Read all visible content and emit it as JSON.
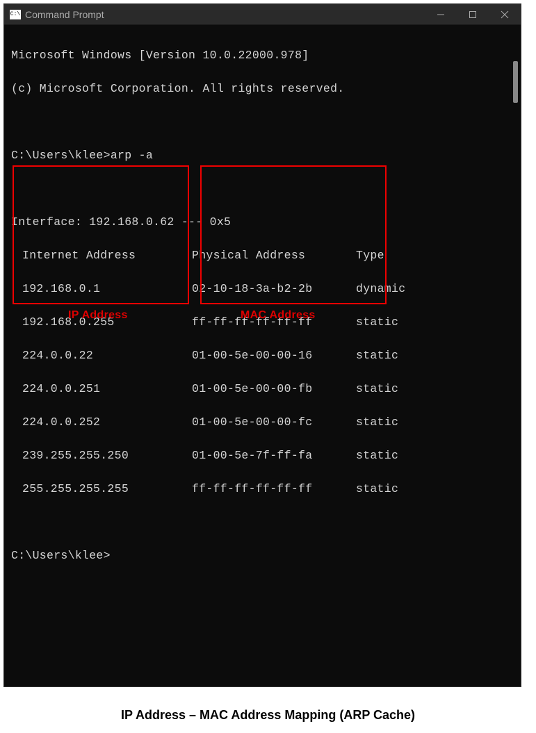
{
  "window": {
    "title": "Command Prompt"
  },
  "terminal": {
    "line1": "Microsoft Windows [Version 10.0.22000.978]",
    "line2": "(c) Microsoft Corporation. All rights reserved.",
    "prompt1_path": "C:\\Users\\klee>",
    "prompt1_cmd": "arp -a",
    "interface_line": "Interface: 192.168.0.62 --- 0x5",
    "header_ip": "Internet Address",
    "header_mac": "Physical Address",
    "header_type": "Type",
    "rows": [
      {
        "ip": "192.168.0.1",
        "mac": "02-10-18-3a-b2-2b",
        "type": "dynamic"
      },
      {
        "ip": "192.168.0.255",
        "mac": "ff-ff-ff-ff-ff-ff",
        "type": "static"
      },
      {
        "ip": "224.0.0.22",
        "mac": "01-00-5e-00-00-16",
        "type": "static"
      },
      {
        "ip": "224.0.0.251",
        "mac": "01-00-5e-00-00-fb",
        "type": "static"
      },
      {
        "ip": "224.0.0.252",
        "mac": "01-00-5e-00-00-fc",
        "type": "static"
      },
      {
        "ip": "239.255.255.250",
        "mac": "01-00-5e-7f-ff-fa",
        "type": "static"
      },
      {
        "ip": "255.255.255.255",
        "mac": "ff-ff-ff-ff-ff-ff",
        "type": "static"
      }
    ],
    "prompt2_path": "C:\\Users\\klee>"
  },
  "annotations": {
    "ip_label": "IP Address",
    "mac_label": "MAC Address"
  },
  "caption": "IP Address – MAC Address Mapping (ARP Cache)"
}
